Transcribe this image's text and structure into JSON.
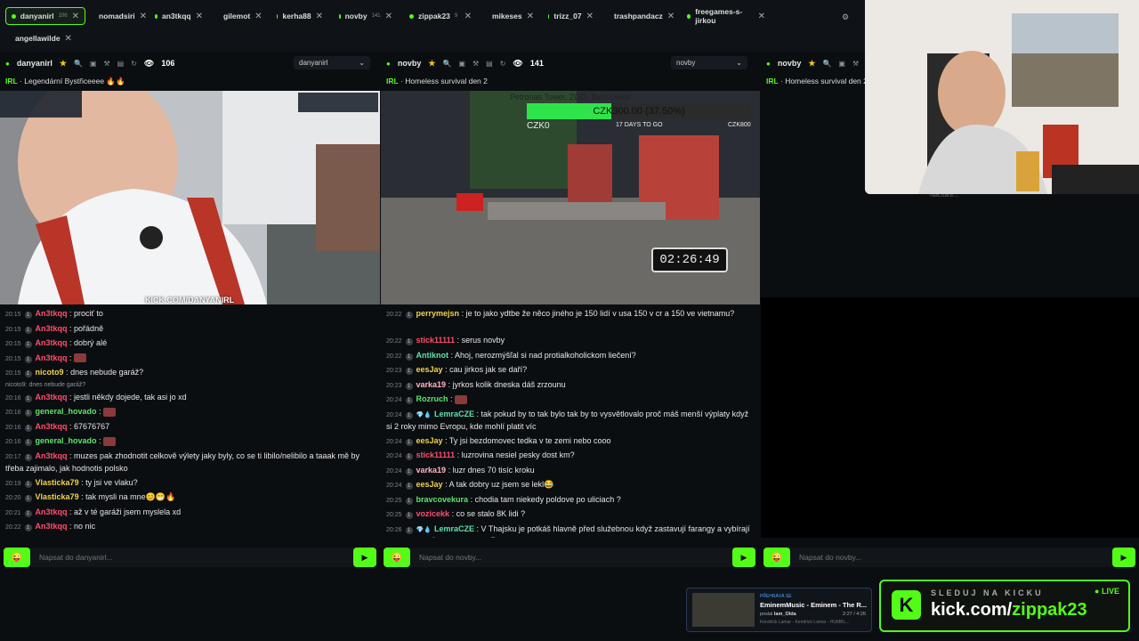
{
  "tabs": [
    {
      "name": "danyanirl",
      "count": "106",
      "active": true
    },
    {
      "name": "nomadsiri",
      "count": ""
    },
    {
      "name": "an3tkqq",
      "count": ""
    },
    {
      "name": "gilemot",
      "count": ""
    },
    {
      "name": "kerha88",
      "count": ""
    },
    {
      "name": "novby",
      "count": "141"
    },
    {
      "name": "zippak23",
      "count": "9"
    },
    {
      "name": "mikeses",
      "count": ""
    },
    {
      "name": "trizz_07",
      "count": ""
    },
    {
      "name": "trashpandacz",
      "count": ""
    },
    {
      "name": "freegames-s-jirkou",
      "count": ""
    },
    {
      "name": "angellawilde",
      "count": ""
    }
  ],
  "panels": [
    {
      "channel": "danyanirl",
      "viewers": "106",
      "select": "danyanirl",
      "category": "IRL",
      "title": "Legendární Bystřiceeee 🔥🔥",
      "watermark": "KICK.COM/DANYANIRL",
      "placeholder": "Napsat do danyanirl..."
    },
    {
      "channel": "novby",
      "viewers": "141",
      "select": "novby",
      "category": "IRL",
      "title": "Homeless survival den 2",
      "placeholder": "Napsat do novby..."
    },
    {
      "channel": "novby",
      "category": "IRL",
      "title": "Homeless survival den 2",
      "placeholder": "Napsat do novby...",
      "loading": "Načítání..."
    }
  ],
  "overlay": {
    "goal_title": "Petronas Tower, ZOO, Batu caves",
    "goal_amount": "CZK300.00 (37.50%)",
    "goal_progress": 0.375,
    "goal_start": "CZK0",
    "goal_days": "17 DAYS TO GO",
    "goal_end": "CZK800",
    "timer": "02:26:49"
  },
  "chat1": [
    {
      "t": "20:15",
      "u": "An3tkqq",
      "c": "#ff4d6d",
      "m": "prociť to"
    },
    {
      "t": "20:15",
      "u": "An3tkqq",
      "c": "#ff4d6d",
      "m": "pořádně"
    },
    {
      "t": "20:15",
      "u": "An3tkqq",
      "c": "#ff4d6d",
      "m": "dobrý alé"
    },
    {
      "t": "20:15",
      "u": "An3tkqq",
      "c": "#ff4d6d",
      "m": "",
      "emote": true
    },
    {
      "t": "20:15",
      "u": "nicoto9",
      "c": "#f2d14b",
      "m": "dnes nebude garáž?"
    },
    {
      "reply": "nicoto9: dnes nebude garáž?"
    },
    {
      "t": "20:16",
      "u": "An3tkqq",
      "c": "#ff4d6d",
      "m": "jestli někdy dojede, tak asi jo xd"
    },
    {
      "t": "20:16",
      "u": "general_hovado",
      "c": "#5ee36b",
      "m": "",
      "emote": true
    },
    {
      "t": "20:16",
      "u": "An3tkqq",
      "c": "#ff4d6d",
      "m": "67676767"
    },
    {
      "t": "20:16",
      "u": "general_hovado",
      "c": "#5ee36b",
      "m": "",
      "emote": true
    },
    {
      "t": "20:17",
      "u": "An3tkqq",
      "c": "#ff4d6d",
      "m": "muzes pak zhodnotit celkově výlety jaky byly, co se ti libilo/nelibilo a taaak mě by třeba zajimalo, jak hodnotis polsko",
      "two": true
    },
    {
      "t": "20:19",
      "u": "Vlasticka79",
      "c": "#f2d14b",
      "m": "ty jsi ve vlaku?"
    },
    {
      "t": "20:20",
      "u": "Vlasticka79",
      "c": "#f2d14b",
      "m": "tak mysli na mne😊😁🔥"
    },
    {
      "t": "20:21",
      "u": "An3tkqq",
      "c": "#ff4d6d",
      "m": "až v té garáži jsem myslela xd"
    },
    {
      "t": "20:22",
      "u": "An3tkqq",
      "c": "#ff4d6d",
      "m": "no nic"
    }
  ],
  "chat2": [
    {
      "t": "20:22",
      "u": "perrymejsn",
      "c": "#f2d14b",
      "m": "je to jako ydtbe že něco jiného je 150 lidí v usa 150 v cr a 150 ve vietnamu?",
      "two": true
    },
    {
      "t": "20:22",
      "u": "stick11111",
      "c": "#ff4d6d",
      "m": "serus novby"
    },
    {
      "t": "20:22",
      "u": "Antiknot",
      "c": "#5ee3a8",
      "m": "Ahoj, nerozmýšľal si nad protialkoholickom liečení?"
    },
    {
      "t": "20:23",
      "u": "eesJay",
      "c": "#f2d14b",
      "m": "cau jirkos jak se daří?"
    },
    {
      "t": "20:23",
      "u": "varka19",
      "c": "#ffb3c6",
      "m": "jyrkos kolik dneska dáš zrzounu"
    },
    {
      "t": "20:24",
      "u": "Rozruch",
      "c": "#5ee36b",
      "m": "",
      "emote": true
    },
    {
      "t": "20:24",
      "u": "LemraCZE",
      "c": "#5ee3a8",
      "m": "tak pokud by to tak bylo tak by to vysvětlovalo proč máš menší výplaty když si 2 roky mimo Evropu, kde mohlí platit víc",
      "two": true,
      "badges": "💎💧"
    },
    {
      "t": "20:24",
      "u": "eesJay",
      "c": "#f2d14b",
      "m": "Ty jsi bezdomovec tedka v te zemi nebo cooo"
    },
    {
      "t": "20:24",
      "u": "stick11111",
      "c": "#ff4d6d",
      "m": "luzrovina nesiel pesky dost km?"
    },
    {
      "t": "20:24",
      "u": "varka19",
      "c": "#ffb3c6",
      "m": "luzr dnes 70 tisíc kroku"
    },
    {
      "t": "20:24",
      "u": "eesJay",
      "c": "#f2d14b",
      "m": "A tak dobry uz jsem se lekl😂"
    },
    {
      "t": "20:25",
      "u": "bravcovekura",
      "c": "#5ee36b",
      "m": "chodia tam niekedy poldove po uliciach ?"
    },
    {
      "t": "20:25",
      "u": "vozicekk",
      "c": "#ff4d6d",
      "m": "co se stalo 8K lidi ?"
    },
    {
      "t": "20:26",
      "u": "LemraCZE",
      "c": "#5ee3a8",
      "m": "V Thajsku je potkáš hlavně před služebnou když zastavují farangy a vybírají úplatky za průjezd na skutru 😡",
      "two": true,
      "badges": "💎💧"
    }
  ],
  "promo": {
    "tag": "PŘEHRÁVÁ SE",
    "song": "EminemMusic - Eminem - The R...",
    "time": "2:27 / 4:26",
    "by_label": "poslal",
    "by_user": "lam_Olda",
    "artist": "Kendrick Lamar - Kendrick Lamar - HUMBL...",
    "cta": "SLEDUJ NA KICKU",
    "live": "LIVE",
    "url_prefix": "kick.com/",
    "url_user": "zippak23"
  }
}
